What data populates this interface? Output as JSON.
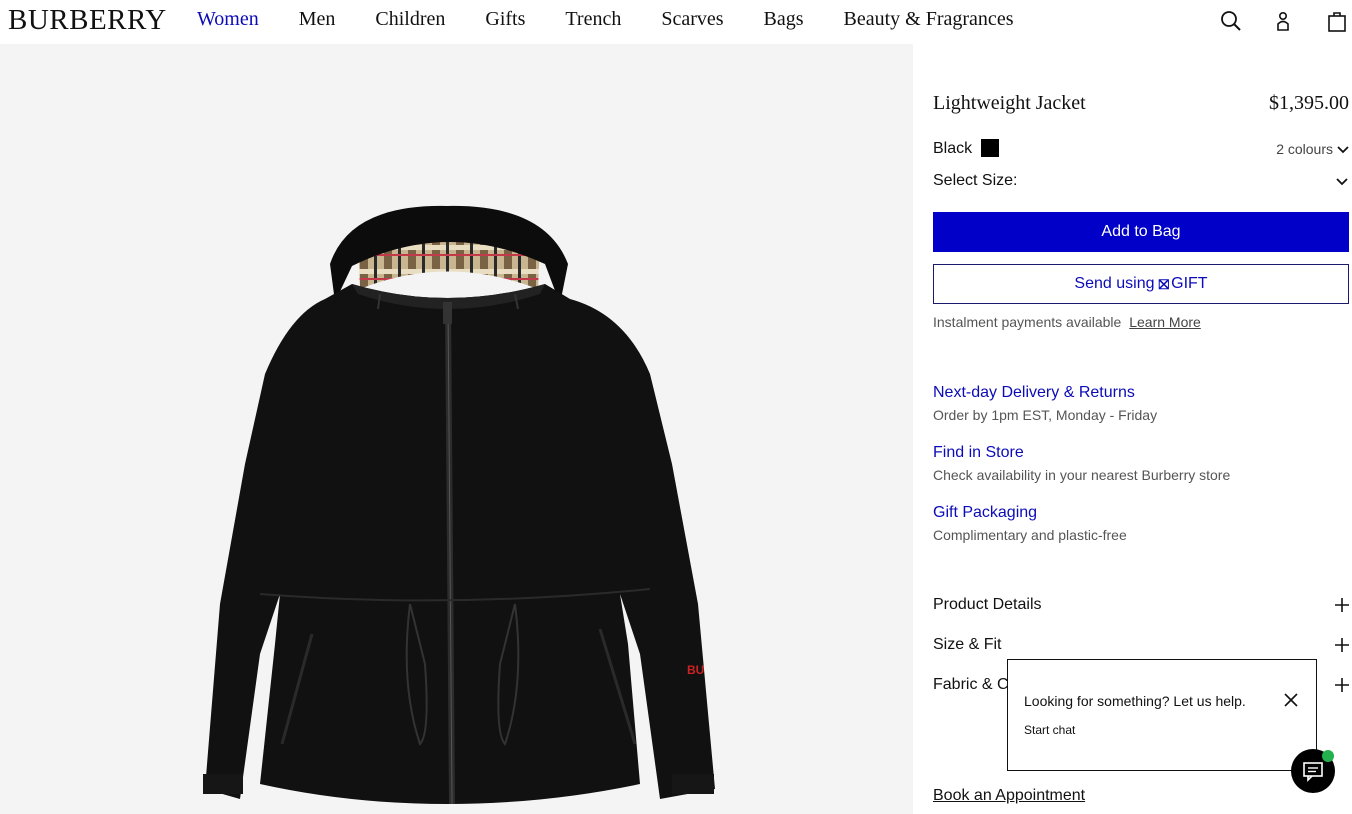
{
  "brand": "BURBERRY",
  "nav": [
    {
      "label": "Women",
      "active": true
    },
    {
      "label": "Men"
    },
    {
      "label": "Children"
    },
    {
      "label": "Gifts"
    },
    {
      "label": "Trench"
    },
    {
      "label": "Scarves"
    },
    {
      "label": "Bags"
    },
    {
      "label": "Beauty & Fragrances"
    }
  ],
  "header_icons": [
    "search-icon",
    "account-icon",
    "bag-icon"
  ],
  "product": {
    "title": "Lightweight Jacket",
    "price": "$1,395.00",
    "colour": "Black",
    "colour_hex": "#000000",
    "colours_link": "2 colours",
    "size_label": "Select Size:",
    "image_sleeve_text": "BU"
  },
  "buttons": {
    "add_to_bag": "Add to Bag",
    "send_prefix": "Send using",
    "send_suffix": "GIFT"
  },
  "instalment": {
    "text": "Instalment payments available",
    "link": "Learn More"
  },
  "services": [
    {
      "title": "Next-day Delivery & Returns",
      "sub": "Order by 1pm EST, Monday - Friday"
    },
    {
      "title": "Find in Store",
      "sub": "Check availability in your nearest Burberry store"
    },
    {
      "title": "Gift Packaging",
      "sub": "Complimentary and plastic-free"
    }
  ],
  "accordions": [
    "Product Details",
    "Size & Fit",
    "Fabric & Care"
  ],
  "book_appointment": "Book an Appointment",
  "chat": {
    "question": "Looking for something? Let us help.",
    "start": "Start chat"
  },
  "colors": {
    "accent": "#0000c8",
    "link": "#0b0bb8",
    "image_bg": "#f4f4f4",
    "chat_status": "#22b14c"
  }
}
